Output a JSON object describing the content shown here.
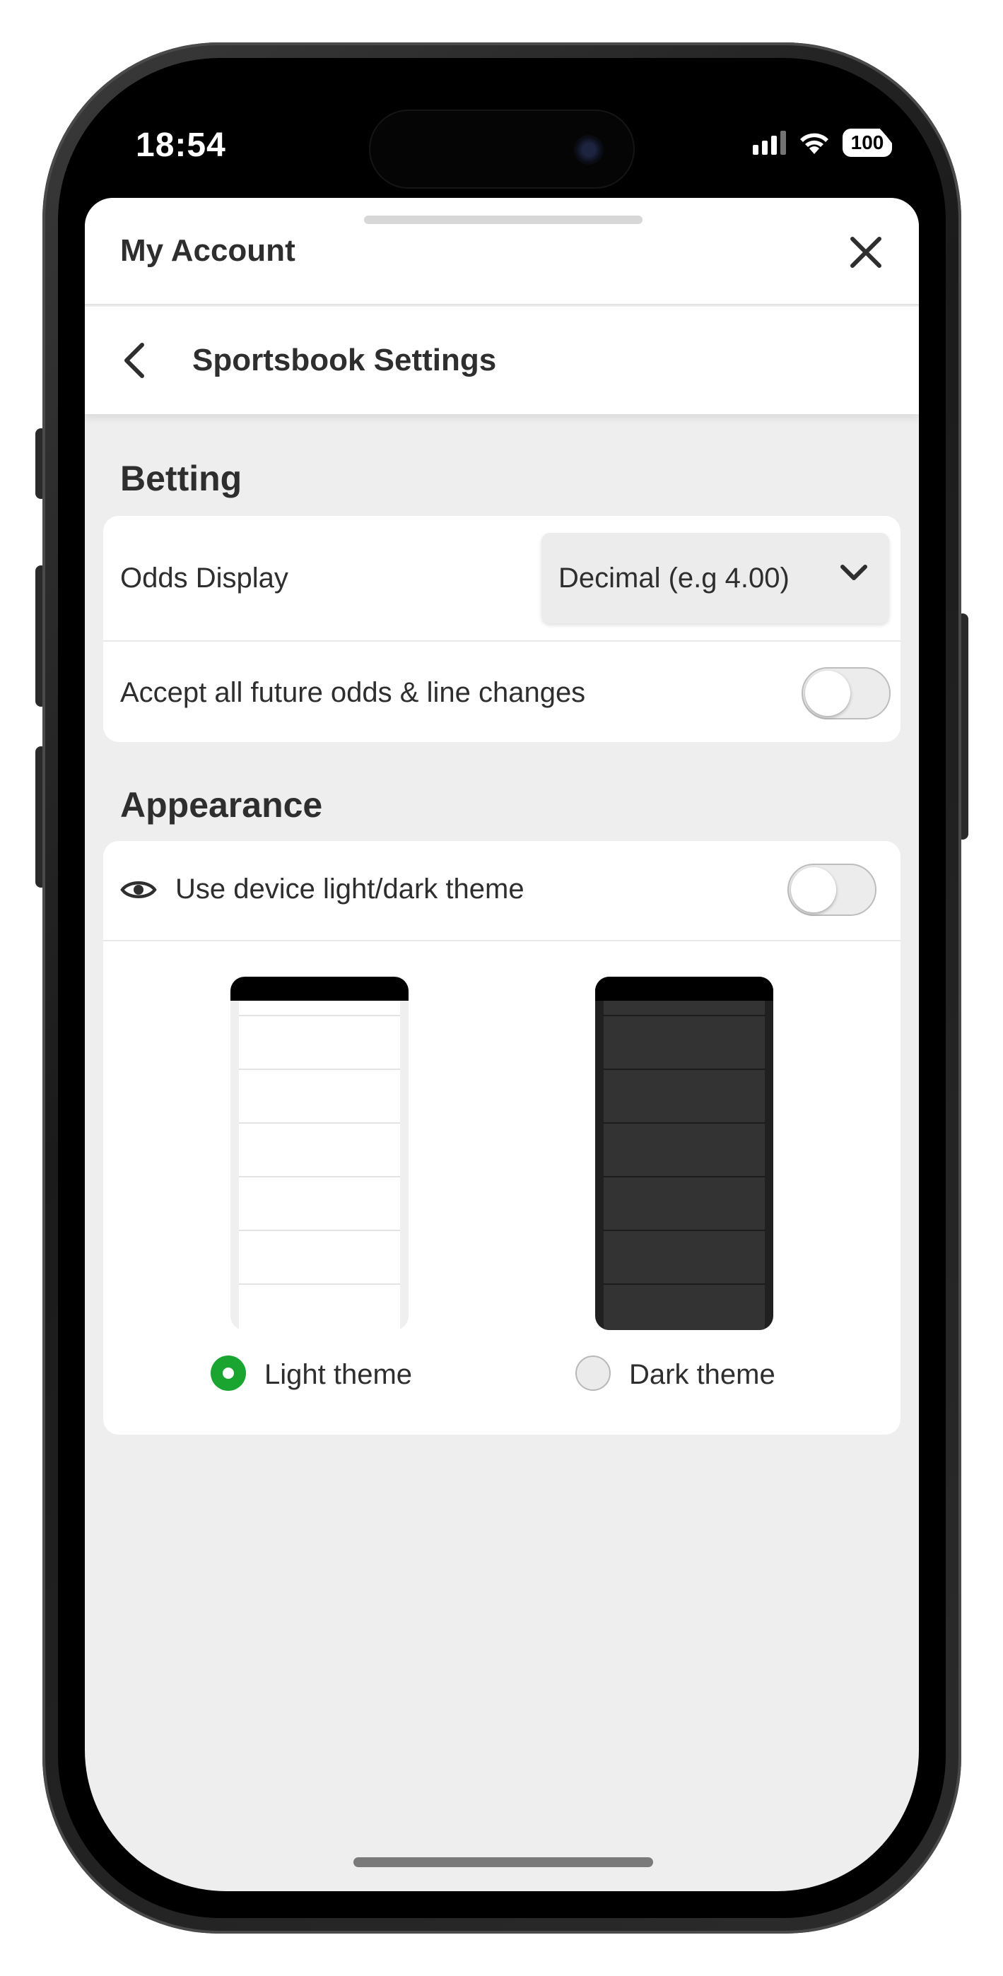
{
  "status_bar": {
    "time": "18:54",
    "battery": "100"
  },
  "header": {
    "title": "My Account",
    "close_icon": "close-icon"
  },
  "subheader": {
    "title": "Sportsbook Settings",
    "back_icon": "chevron-left-icon"
  },
  "betting": {
    "section_title": "Betting",
    "odds_display_label": "Odds Display",
    "odds_display_value": "Decimal (e.g 4.00)",
    "accept_changes_label": "Accept all future odds & line changes",
    "accept_changes_enabled": false
  },
  "appearance": {
    "section_title": "Appearance",
    "device_theme_label": "Use device light/dark theme",
    "device_theme_enabled": false,
    "themes": [
      {
        "label": "Light theme",
        "selected": true
      },
      {
        "label": "Dark theme",
        "selected": false
      }
    ]
  },
  "colors": {
    "accent": "#1aa531",
    "sheet_bg": "#eeeeee",
    "card_bg": "#ffffff"
  }
}
